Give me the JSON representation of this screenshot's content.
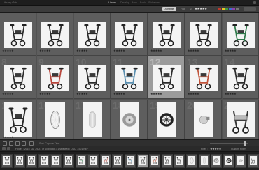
{
  "app": {
    "title": "Library Grid",
    "modules": [
      "Library",
      "Develop",
      "Map",
      "Book",
      "Slideshow",
      "Print",
      "Web"
    ],
    "active_module": "Library"
  },
  "filter_bar": {
    "label": "Attribute",
    "logic": "Flag",
    "rating_op": "≥",
    "stars": "★★★★★",
    "color_labels": [
      "#c0392b",
      "#e6c229",
      "#3e9b3e",
      "#3f6fd0",
      "#8e44ad",
      "#777777"
    ]
  },
  "grid": {
    "cells": [
      {
        "num": "",
        "product": "walker",
        "frame": "#2b2b2b",
        "rating": "★★★★★"
      },
      {
        "num": "",
        "product": "walker",
        "frame": "#2b2b2b",
        "rating": "★★★★★"
      },
      {
        "num": "",
        "product": "walker",
        "frame": "#2b2b2b",
        "rating": "★★★★★"
      },
      {
        "num": "",
        "product": "walker",
        "frame": "#2b2b2b",
        "rating": "★★★★★"
      },
      {
        "num": "",
        "product": "walker",
        "frame": "#2b2b2b",
        "rating": "★★★★★"
      },
      {
        "num": "",
        "product": "walker",
        "frame": "#2b2b2b",
        "rating": "★★★★★"
      },
      {
        "num": "",
        "product": "walker",
        "frame": "#2f7a4a",
        "rating": "★★★★★"
      },
      {
        "num": "8",
        "product": "walker",
        "frame": "#2b2b2b",
        "rating": "★★★★★"
      },
      {
        "num": "9",
        "product": "walker",
        "frame": "#b8453b",
        "rating": "★★★★★"
      },
      {
        "num": "10",
        "product": "walker",
        "frame": "#2b2b2b",
        "rating": "★★★★★"
      },
      {
        "num": "11",
        "product": "walker",
        "frame": "#5a8fb0",
        "rating": "★★★★★"
      },
      {
        "num": "12",
        "product": "walker",
        "frame": "#2b2b2b",
        "rating": "★★★★★",
        "selected": true
      },
      {
        "num": "13",
        "product": "walker",
        "frame": "#c0533a",
        "rating": "★★★★★"
      },
      {
        "num": "14",
        "product": "walker",
        "frame": "#2b2b2b",
        "rating": "★★★★★"
      },
      {
        "num": "15",
        "product": "walker",
        "frame": "#2b2b2b",
        "rating": "★★★★★"
      },
      {
        "num": "16",
        "product": "wheel-large",
        "frame": "#2b2b2b",
        "rating": ""
      },
      {
        "num": "17",
        "product": "wheel-front",
        "frame": "#2b2b2b",
        "rating": ""
      },
      {
        "num": "18",
        "product": "wheel-tire",
        "frame": "#2b2b2b",
        "rating": ""
      },
      {
        "num": "19",
        "product": "wheel-black",
        "frame": "#2b2b2b",
        "rating": ""
      },
      {
        "num": "20",
        "product": "wheel-castor",
        "frame": "#2b2b2b",
        "rating": ""
      },
      {
        "num": "21",
        "product": "walker-seat",
        "frame": "#2b2b2b",
        "rating": ""
      }
    ]
  },
  "toolbar": {
    "sort_label": "Sort: Capture Time",
    "thumbnails_label": "Thumbnails"
  },
  "filmstrip": {
    "source_text": "Folder : 2016_02_29    21 of 40 photos / 1 selected / DSC_2301.NEF",
    "filter_label": "Filter :",
    "stars": "★★★★★",
    "preset": "Custom Filter",
    "selected_index": 11,
    "count": 21
  }
}
